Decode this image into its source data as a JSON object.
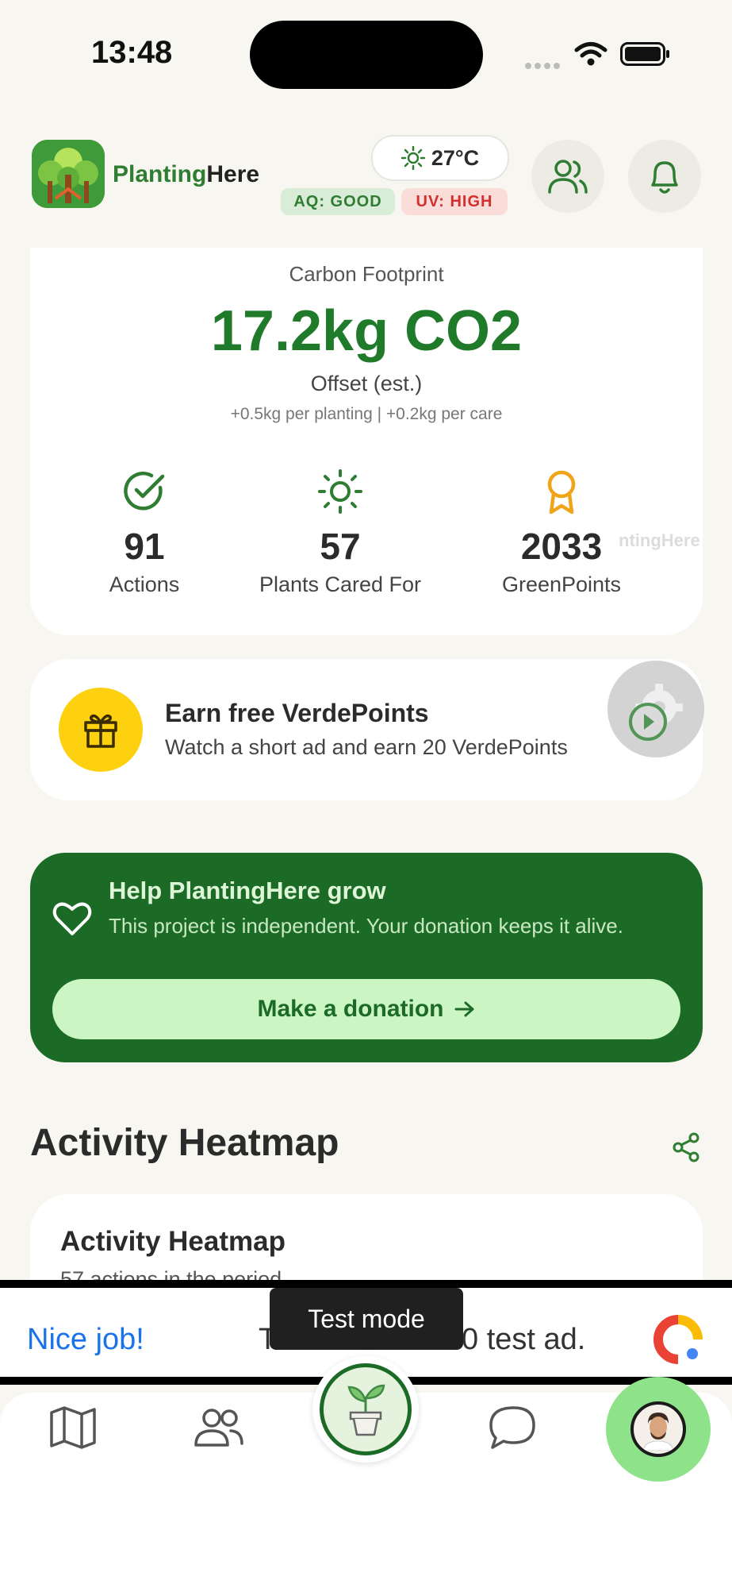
{
  "status_bar": {
    "time": "13:48"
  },
  "header": {
    "brand_part1": "Planting",
    "brand_part2": "Here",
    "temperature": "27°C",
    "air_quality": "AQ: GOOD",
    "uv_index": "UV: HIGH"
  },
  "carbon": {
    "title": "Carbon Footprint",
    "value": "17.2kg CO2",
    "subtitle": "Offset (est.)",
    "note": "+0.5kg per planting | +0.2kg per care",
    "stats": [
      {
        "value": "91",
        "label": "Actions",
        "icon": "check-circle-icon"
      },
      {
        "value": "57",
        "label": "Plants Cared For",
        "icon": "sun-icon"
      },
      {
        "value": "2033",
        "label": "GreenPoints",
        "icon": "award-icon"
      }
    ],
    "watermark": "ntingHere"
  },
  "earn": {
    "title": "Earn free VerdePoints",
    "subtitle": "Watch a short ad and earn 20 VerdePoints"
  },
  "donation": {
    "title": "Help PlantingHere grow",
    "text": "This project is independent. Your donation keeps it alive.",
    "button": "Make a donation"
  },
  "heatmap": {
    "section_title": "Activity Heatmap",
    "card_title": "Activity Heatmap",
    "card_subtitle": "57 actions in the period"
  },
  "ad": {
    "left_text": "Nice job!",
    "center_text_start": "T",
    "center_text_end": "0 test ad.",
    "toast": "Test mode"
  },
  "colors": {
    "brand_green": "#2e7d32",
    "dark_green": "#1b6b27",
    "gift_yellow": "#fdd10f",
    "ad_blue": "#1a73e8"
  }
}
